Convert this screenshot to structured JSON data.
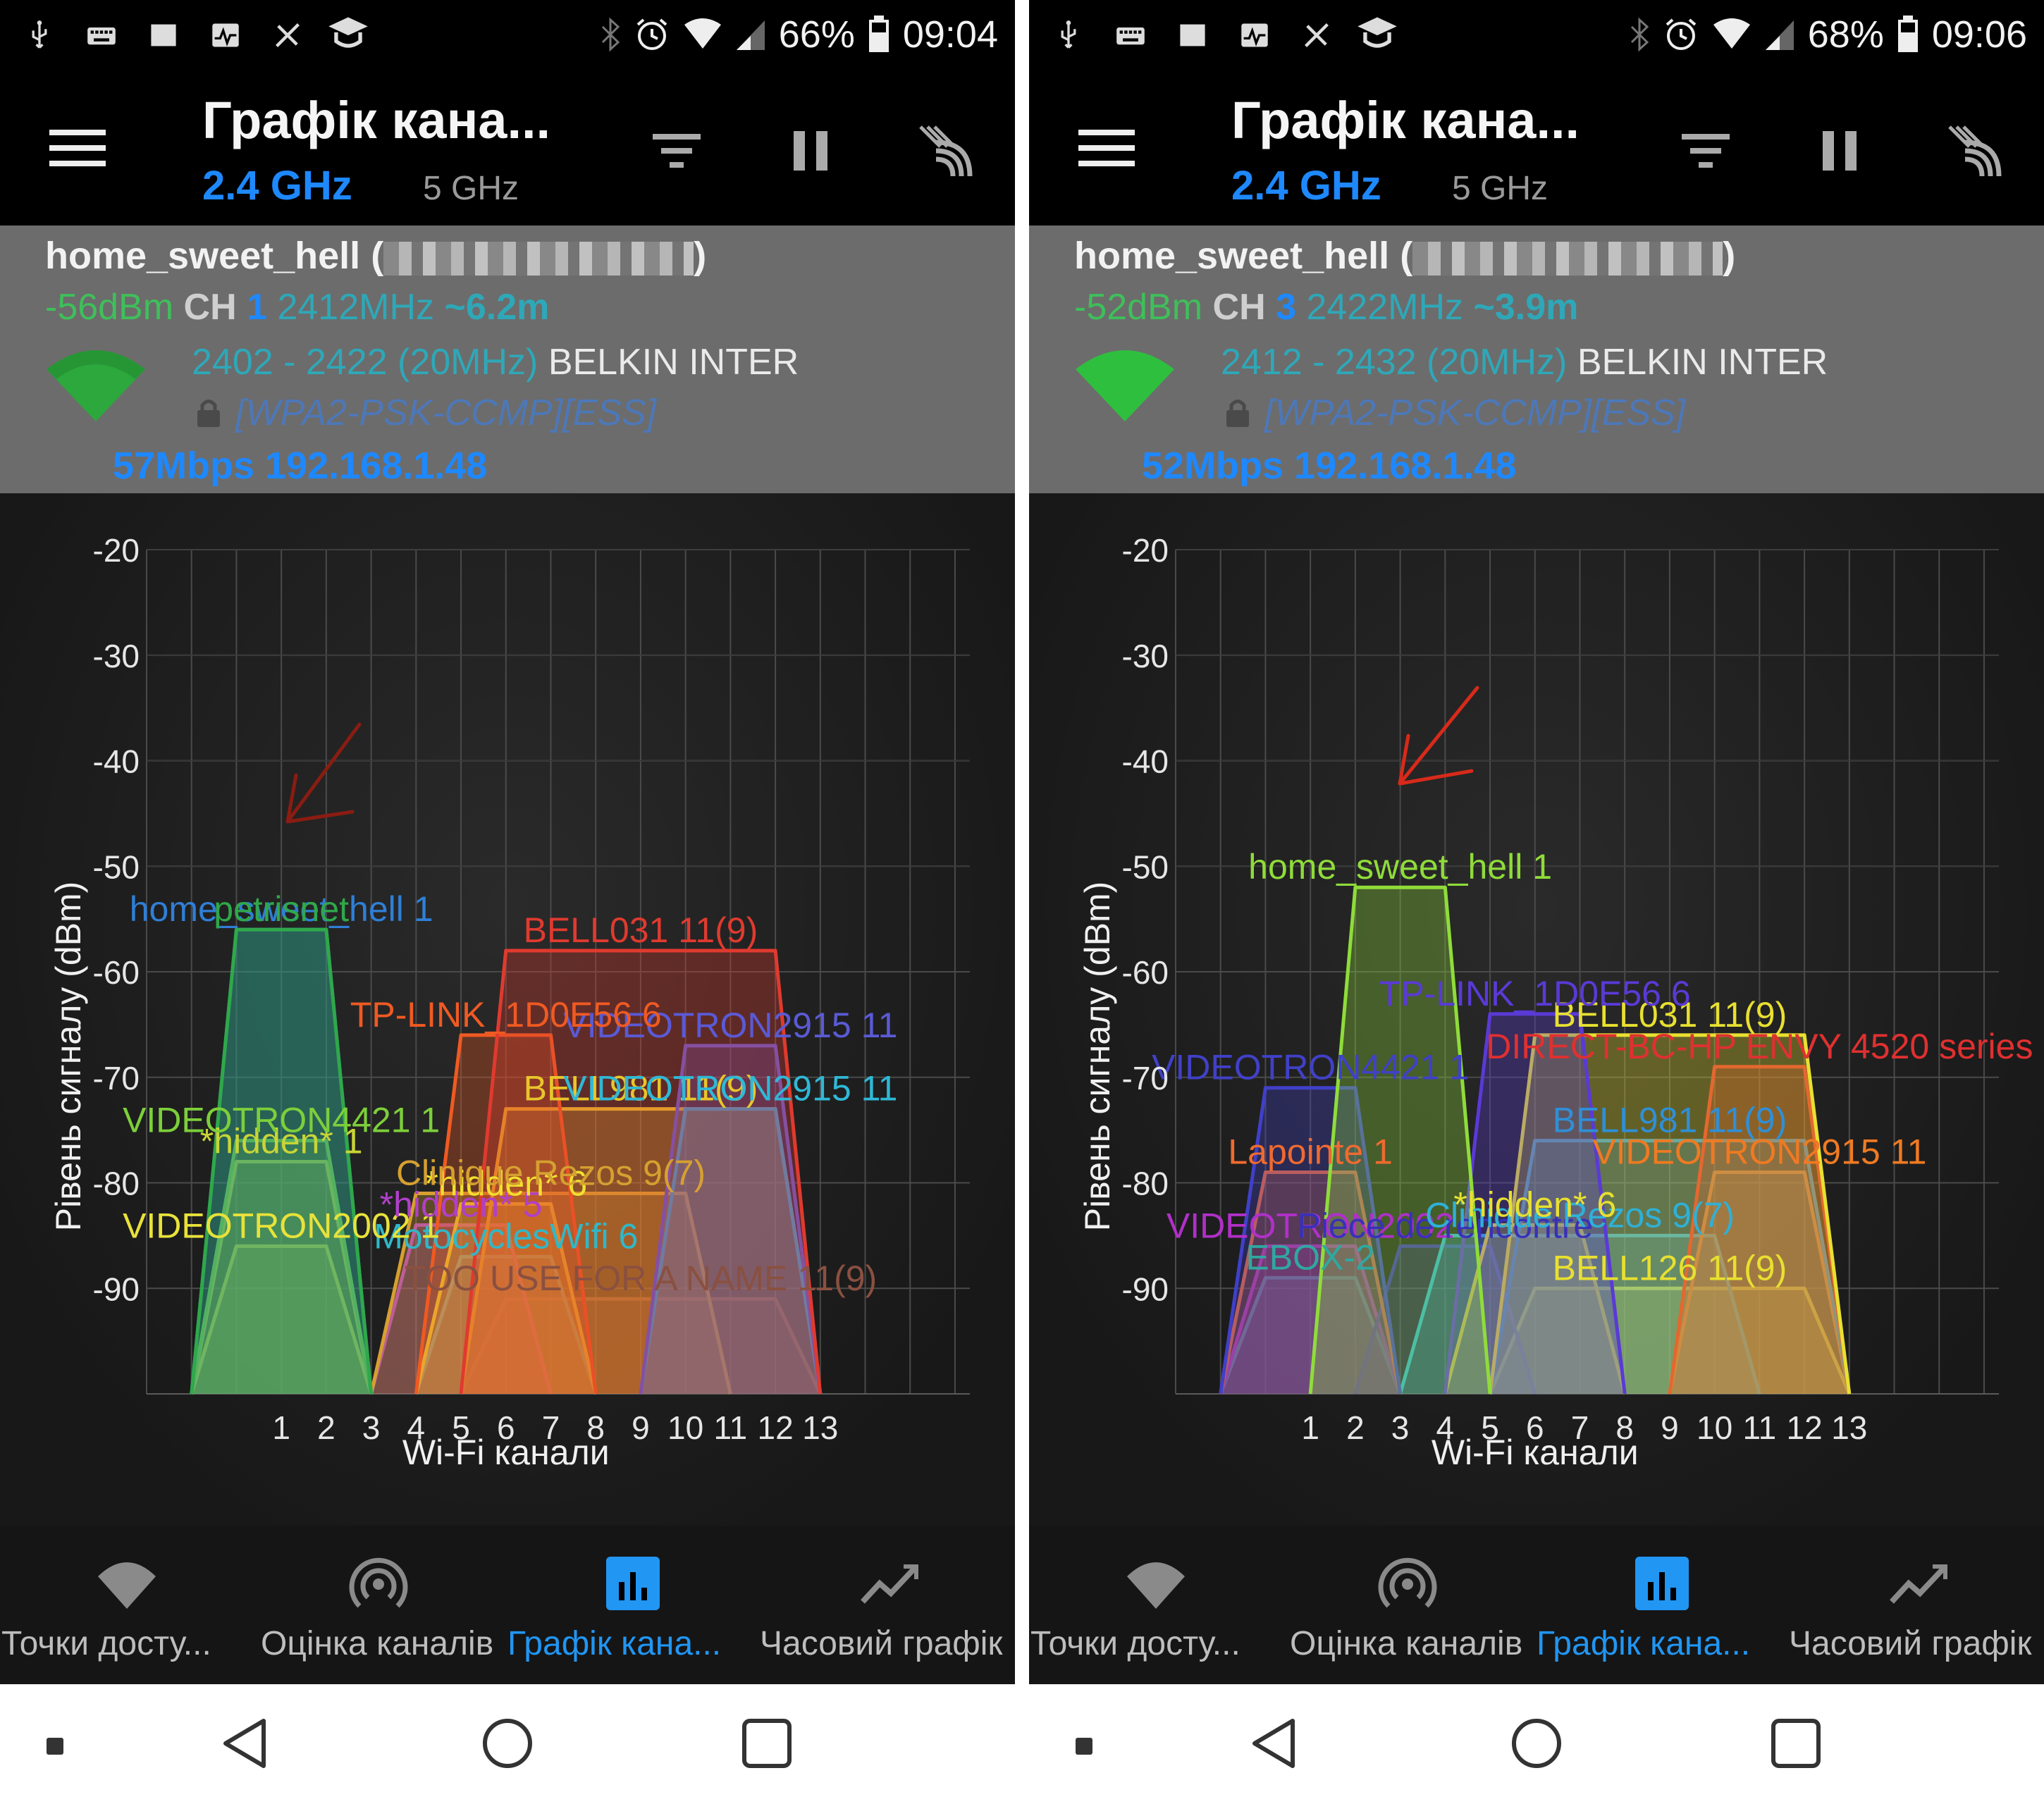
{
  "app": {
    "title": "Графік кана...",
    "band_active": "2.4 GHz",
    "band_inactive": "5 GHz"
  },
  "colors": {
    "accent_blue": "#1e88ff",
    "signal_green": "#3fbf5a",
    "info_bg": "#6c6c6c",
    "app_bg": "#000000"
  },
  "nav": {
    "items": [
      {
        "label": "Точки досту...",
        "icon": "wifi-icon",
        "active": false
      },
      {
        "label": "Оцінка каналів",
        "icon": "signal-rings-icon",
        "active": false
      },
      {
        "label": "Графік кана...",
        "icon": "bar-chart-icon",
        "active": true
      },
      {
        "label": "Часовий графік",
        "icon": "line-chart-icon",
        "active": false
      }
    ]
  },
  "panels": [
    {
      "status": {
        "battery": "66%",
        "time": "09:04"
      },
      "connection": {
        "ssid": "home_sweet_hell",
        "paren_open": "(",
        "paren_close": ")",
        "dbm": "-56dBm",
        "ch_label": "CH",
        "ch_value": "1",
        "freq": "2412MHz",
        "distance": "~6.2m",
        "range": "2402 - 2422 (20MHz)",
        "vendor": "BELKIN INTER",
        "security": "[WPA2-PSK-CCMP][ESS]",
        "speed_ip": "57Mbps 192.168.1.48"
      }
    },
    {
      "status": {
        "battery": "68%",
        "time": "09:06"
      },
      "connection": {
        "ssid": "home_sweet_hell",
        "paren_open": "(",
        "paren_close": ")",
        "dbm": "-52dBm",
        "ch_label": "CH",
        "ch_value": "3",
        "freq": "2422MHz",
        "distance": "~3.9m",
        "range": "2412 - 2432 (20MHz)",
        "vendor": "BELKIN INTER",
        "security": "[WPA2-PSK-CCMP][ESS]",
        "speed_ip": "52Mbps 192.168.1.48"
      }
    }
  ],
  "chart_data": [
    {
      "type": "area",
      "xlabel": "Wi-Fi канали",
      "ylabel": "Рівень сигналу (dBm)",
      "x_ticks": [
        1,
        2,
        3,
        4,
        5,
        6,
        7,
        8,
        9,
        10,
        11,
        12,
        13
      ],
      "y_ticks": [
        -20,
        -30,
        -40,
        -50,
        -60,
        -70,
        -80,
        -90
      ],
      "ylim": [
        -100,
        -20
      ],
      "grid": true,
      "series": [
        {
          "name": "home_sweet_hell 1",
          "center": 1,
          "width": 4,
          "level": -56,
          "color": "#2f7fd6"
        },
        {
          "name": "petrisnet",
          "center": 1,
          "width": 4,
          "level": -56,
          "color": "#2fa84a"
        },
        {
          "name": "VIDEOTRON4421 1",
          "center": 1,
          "width": 4,
          "level": -76,
          "color": "#7ccf3a"
        },
        {
          "name": "*hidden* 1",
          "center": 1,
          "width": 4,
          "level": -78,
          "color": "#c9d436"
        },
        {
          "name": "VIDEOTRON2002 1",
          "center": 1,
          "width": 4,
          "level": -86,
          "color": "#e8e23a"
        },
        {
          "name": "BELL031 11(9)",
          "center": 9,
          "width": 8,
          "level": -58,
          "color": "#e03a2f"
        },
        {
          "name": "TP-LINK_1D0E56 6",
          "center": 6,
          "width": 4,
          "level": -66,
          "color": "#ef5a22"
        },
        {
          "name": "VIDEOTRON2915 11",
          "center": 11,
          "width": 4,
          "level": -67,
          "color": "#5a5ad6"
        },
        {
          "name": "BELL981 11(9)",
          "center": 9,
          "width": 8,
          "level": -73,
          "color": "#e8c62a"
        },
        {
          "name": "VIDEOTRON2915 11",
          "center": 11,
          "width": 4,
          "level": -73,
          "color": "#2fb8d6"
        },
        {
          "name": "Clinique Rezos 9(7)",
          "center": 7,
          "width": 8,
          "level": -81,
          "color": "#d6a030"
        },
        {
          "name": "*hidden* 6",
          "center": 6,
          "width": 4,
          "level": -82,
          "color": "#f0e030"
        },
        {
          "name": "*hidden* 5",
          "center": 5,
          "width": 4,
          "level": -84,
          "color": "#b040c8"
        },
        {
          "name": "MotocyclesWifi 6",
          "center": 6,
          "width": 4,
          "level": -87,
          "color": "#2fb8c8"
        },
        {
          "name": "TOO USE FOR A NAME 11(9)",
          "center": 9,
          "width": 8,
          "level": -91,
          "color": "#8a5040"
        }
      ]
    },
    {
      "type": "area",
      "xlabel": "Wi-Fi канали",
      "ylabel": "Рівень сигналу (dBm)",
      "x_ticks": [
        1,
        2,
        3,
        4,
        5,
        6,
        7,
        8,
        9,
        10,
        11,
        12,
        13
      ],
      "y_ticks": [
        -20,
        -30,
        -40,
        -50,
        -60,
        -70,
        -80,
        -90
      ],
      "ylim": [
        -100,
        -20
      ],
      "grid": true,
      "series": [
        {
          "name": "home_sweet_hell 1",
          "center": 3,
          "width": 4,
          "level": -52,
          "color": "#8fdc3a"
        },
        {
          "name": "TP-LINK_1D0E56 6",
          "center": 6,
          "width": 4,
          "level": -64,
          "color": "#5a3ad6"
        },
        {
          "name": "BELL031 11(9)",
          "center": 9,
          "width": 8,
          "level": -66,
          "color": "#e8e030"
        },
        {
          "name": "DIRECT-BC-HP ENVY 4520 series",
          "center": 11,
          "width": 4,
          "level": -69,
          "color": "#e03030"
        },
        {
          "name": "VIDEOTRON4421 1",
          "center": 1,
          "width": 4,
          "level": -71,
          "color": "#4040c8"
        },
        {
          "name": "BELL981 11(9)",
          "center": 9,
          "width": 8,
          "level": -76,
          "color": "#2f8fd6"
        },
        {
          "name": "VIDEOTRON2915 11",
          "center": 11,
          "width": 4,
          "level": -79,
          "color": "#ef7a22"
        },
        {
          "name": "Lapointe 1",
          "center": 1,
          "width": 4,
          "level": -79,
          "color": "#ef6a30"
        },
        {
          "name": "*hidden* 6",
          "center": 6,
          "width": 4,
          "level": -84,
          "color": "#e8e030"
        },
        {
          "name": "Clinique Rezos 9(7)",
          "center": 7,
          "width": 8,
          "level": -85,
          "color": "#2fb0d6"
        },
        {
          "name": "VIDEOTRON2002",
          "center": 1,
          "width": 4,
          "level": -86,
          "color": "#b030c8"
        },
        {
          "name": "Piece de rencontre",
          "center": 4,
          "width": 4,
          "level": -86,
          "color": "#3a30b8"
        },
        {
          "name": "EBOX-2",
          "center": 1,
          "width": 4,
          "level": -89,
          "color": "#2fa8a0"
        },
        {
          "name": "BELL126 11(9)",
          "center": 9,
          "width": 8,
          "level": -90,
          "color": "#e8e030"
        }
      ]
    }
  ]
}
